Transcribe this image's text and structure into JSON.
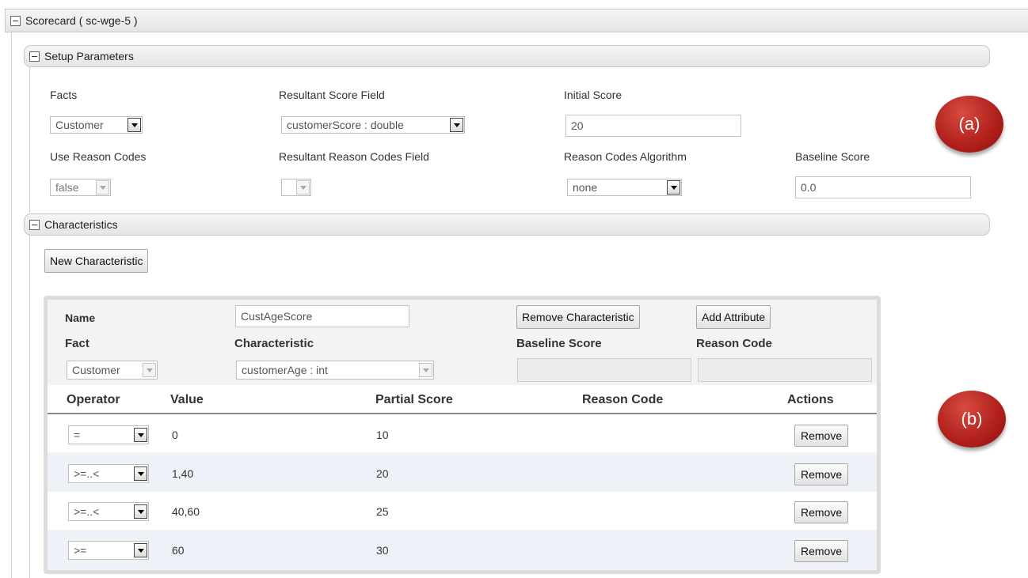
{
  "scorecard": {
    "title": "Scorecard ( sc-wge-5 )"
  },
  "setup": {
    "title": "Setup Parameters",
    "facts_label": "Facts",
    "facts_value": "Customer",
    "resultant_score_label": "Resultant Score Field",
    "resultant_score_value": "customerScore : double",
    "initial_score_label": "Initial Score",
    "initial_score_value": "20",
    "use_reason_codes_label": "Use Reason Codes",
    "use_reason_codes_value": "false",
    "resultant_reason_label": "Resultant Reason Codes Field",
    "resultant_reason_value": "",
    "algorithm_label": "Reason Codes Algorithm",
    "algorithm_value": "none",
    "baseline_label": "Baseline Score",
    "baseline_value": "0.0"
  },
  "characteristics": {
    "title": "Characteristics",
    "new_button": "New Characteristic",
    "card": {
      "name_label": "Name",
      "name_value": "CustAgeScore",
      "remove_button": "Remove Characteristic",
      "add_attribute_button": "Add Attribute",
      "fact_label": "Fact",
      "characteristic_label": "Characteristic",
      "baseline_label": "Baseline Score",
      "reason_code_label": "Reason Code",
      "fact_value": "Customer",
      "characteristic_value": "customerAge : int",
      "baseline_value": "",
      "reason_code_value": ""
    },
    "table": {
      "headers": [
        "Operator",
        "Value",
        "Partial Score",
        "Reason Code",
        "Actions"
      ],
      "rows": [
        {
          "operator": "=",
          "value": "0",
          "partial_score": "10",
          "reason_code": "",
          "action": "Remove"
        },
        {
          "operator": ">=..<",
          "value": "1,40",
          "partial_score": "20",
          "reason_code": "",
          "action": "Remove"
        },
        {
          "operator": ">=..<",
          "value": "40,60",
          "partial_score": "25",
          "reason_code": "",
          "action": "Remove"
        },
        {
          "operator": ">=",
          "value": "60",
          "partial_score": "30",
          "reason_code": "",
          "action": "Remove"
        }
      ]
    }
  },
  "annotations": {
    "a": "(a)",
    "b": "(b)",
    "color": "#b01f1a"
  }
}
